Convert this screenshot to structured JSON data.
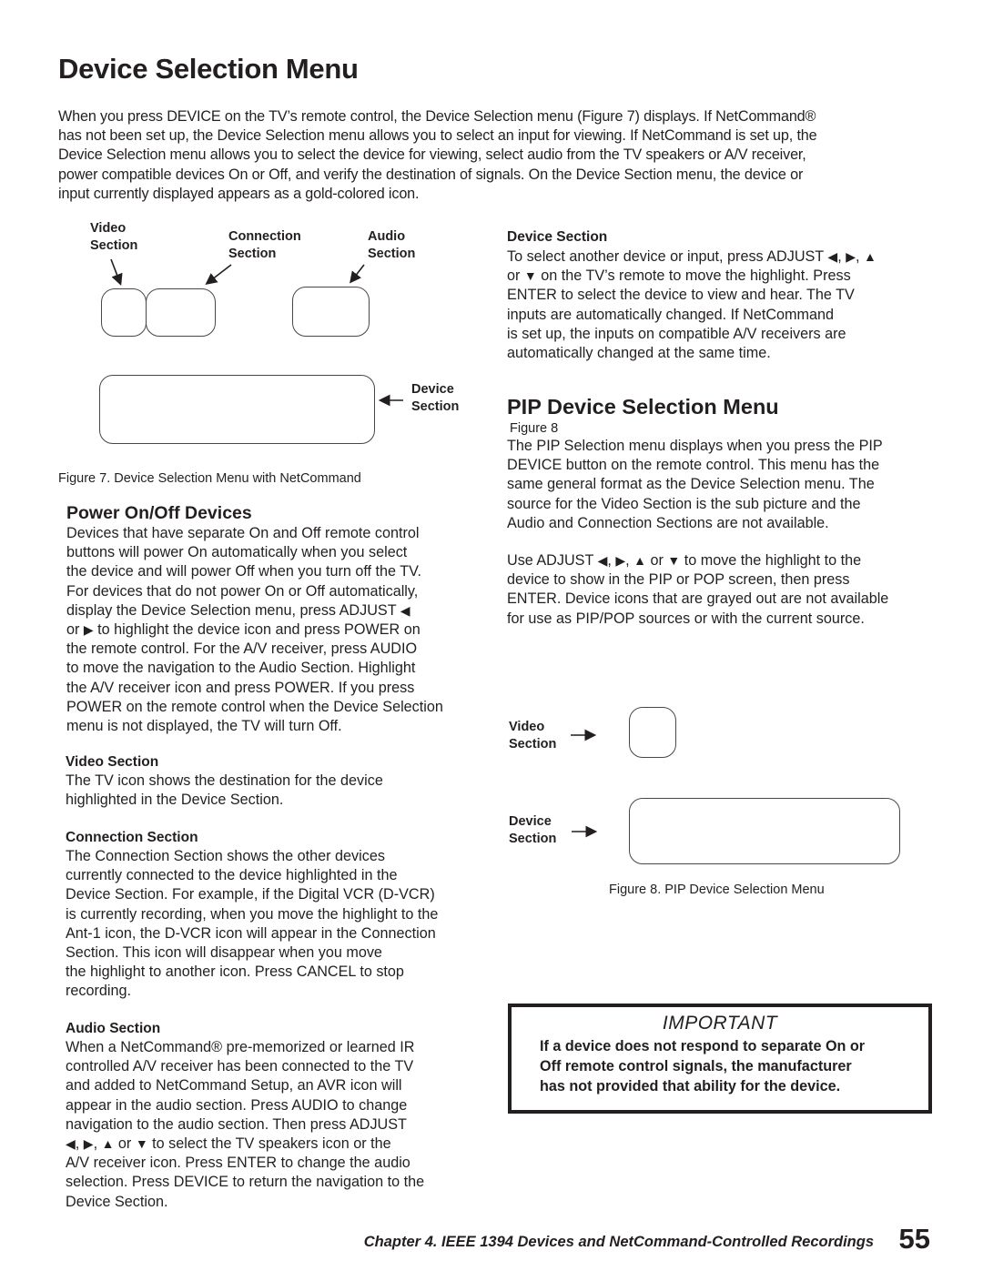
{
  "page": {
    "title": "Device Selection Menu",
    "intro_lines": [
      "When you press DEVICE on the TV’s remote control, the Device Selection menu (Figure 7) displays.  If NetCommand®",
      "has not been set up, the Device Selection menu allows you to select an input for viewing.  If NetCommand is set up, the",
      "Device Selection menu allows you to select the device for viewing, select audio from the TV speakers or A/V receiver,",
      "power compatible devices On or Off, and verify the destination of signals. On the Device Section menu, the device or",
      "input currently displayed appears as a gold-colored icon."
    ]
  },
  "figure7": {
    "labels": {
      "video_line1": "Video",
      "video_line2": "Section",
      "connection_line1": "Connection",
      "connection_line2": "Section",
      "audio_line1": "Audio",
      "audio_line2": "Section",
      "device_line1": "Device",
      "device_line2": "Section"
    },
    "caption": "Figure 7. Device Selection Menu with NetCommand"
  },
  "device_section": {
    "heading": "Device Section",
    "line1_pre": "To select another device or input, press ADJUST ",
    "line2_pre": "or ",
    "line2_post": "  on the TV’s remote to move the highlight.  Press",
    "lines_rest": [
      "ENTER to select the device to view and hear.  The TV",
      "inputs are automatically changed.  If NetCommand",
      "is set up, the inputs on compatible A/V receivers are",
      "automatically changed at the same time."
    ]
  },
  "pip_section": {
    "heading": "PIP Device Selection Menu",
    "figure_ref": "Figure 8",
    "paragraph1": [
      "The PIP Selection menu displays when you press the PIP",
      "DEVICE button on the remote control.  This menu has the",
      "same general format as the Device Selection menu.  The",
      "source for the Video Section is the sub picture and the",
      "Audio and Connection Sections are not available."
    ],
    "p2_line1_pre": "Use ADJUST ",
    "p2_line1_or": " or ",
    "p2_line1_post": "  to move the highlight to the",
    "paragraph2_rest": [
      "device to show in the PIP or POP screen, then press",
      "ENTER.  Device icons that are grayed out are not available",
      "for use as PIP/POP sources or with the current source."
    ]
  },
  "figure8": {
    "labels": {
      "video_line1": "Video",
      "video_line2": "Section",
      "device_line1": "Device",
      "device_line2": "Section"
    },
    "caption": "Figure 8. PIP Device Selection Menu"
  },
  "power_section": {
    "heading": "Power On/Off Devices",
    "lines_a": [
      "Devices that have separate On and Off remote control",
      "buttons will power On automatically when you select",
      "the device and will power Off when you turn off the TV.",
      "For devices that do not power On or Off automatically,"
    ],
    "line_adjust": "display the Device Selection menu, press ADJUST ",
    "line_or_pre": "or ",
    "line_or_post": "  to highlight the device icon and press POWER on",
    "lines_b": [
      "the remote control.  For the A/V receiver, press AUDIO",
      "to move the navigation to the Audio Section.  Highlight",
      "the  A/V receiver icon and press POWER.  If you press",
      "POWER on the remote control when the Device Selection",
      "menu is not displayed, the TV will turn Off."
    ]
  },
  "video_section": {
    "heading": "Video Section",
    "lines": [
      "The TV icon shows the destination for the device",
      "highlighted in the Device Section."
    ]
  },
  "connection_section": {
    "heading": "Connection Section",
    "lines": [
      "The Connection Section shows the other devices",
      "currently connected to the device highlighted in the",
      "Device Section.  For example, if the Digital VCR (D-VCR)",
      "is currently recording, when you move the highlight to the",
      "Ant-1 icon, the D-VCR icon will appear in the Connection",
      "Section.  This icon will disappear when you move",
      "the highlight to another icon.  Press CANCEL to stop",
      "recording."
    ]
  },
  "audio_section": {
    "heading": "Audio Section",
    "lines_a": [
      "When a NetCommand® pre-memorized or learned IR",
      "controlled A/V receiver has been connected to the TV",
      "and added to NetCommand Setup, an AVR icon will",
      "appear in the audio section.  Press AUDIO  to change",
      "navigation to the audio section.  Then press ADJUST"
    ],
    "line_arrows_or": " or ",
    "line_arrows_post": " to select the TV speakers icon or the",
    "lines_b": [
      "A/V receiver icon.  Press ENTER to change the audio",
      "selection.  Press DEVICE to return the navigation to the",
      "Device Section."
    ]
  },
  "important": {
    "title": "IMPORTANT",
    "lines": [
      "If a device does not respond to separate On or",
      "Off remote control signals, the manufacturer",
      "has not provided that ability for the device."
    ]
  },
  "footer": {
    "chapter": "Chapter 4. IEEE 1394 Devices and NetCommand-Controlled Recordings",
    "page_number": "55"
  },
  "glyphs": {
    "left": "◀",
    "right": "▶",
    "up": "▲",
    "down": "▼",
    "comma": ", "
  }
}
